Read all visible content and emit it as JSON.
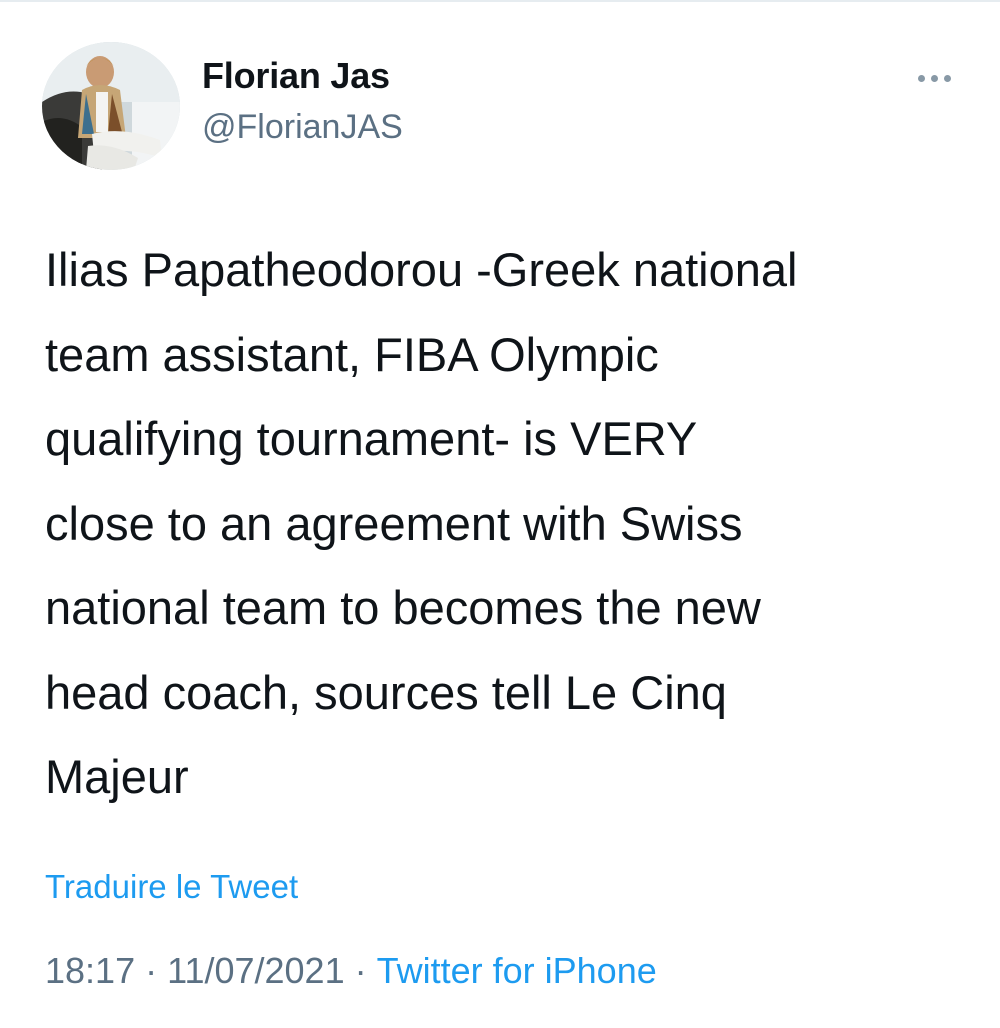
{
  "tweet": {
    "author": {
      "display_name": "Florian Jas",
      "handle": "@FlorianJAS"
    },
    "text": "Ilias Papatheodorou -Greek national\nteam assistant, FIBA Olympic\nqualifying tournament- is VERY\nclose to an agreement with Swiss\nnational team to becomes the new\nhead coach, sources tell Le Cinq\nMajeur",
    "translate_label": "Traduire le Tweet",
    "time": "18:17",
    "separator": "·",
    "date": "11/07/2021",
    "source": "Twitter for iPhone"
  },
  "icons": {
    "more": "more-horizontal-icon"
  },
  "colors": {
    "text": "#0f1419",
    "secondary": "#5b7083",
    "link": "#1d9bf0",
    "border": "#e6ecf0"
  }
}
